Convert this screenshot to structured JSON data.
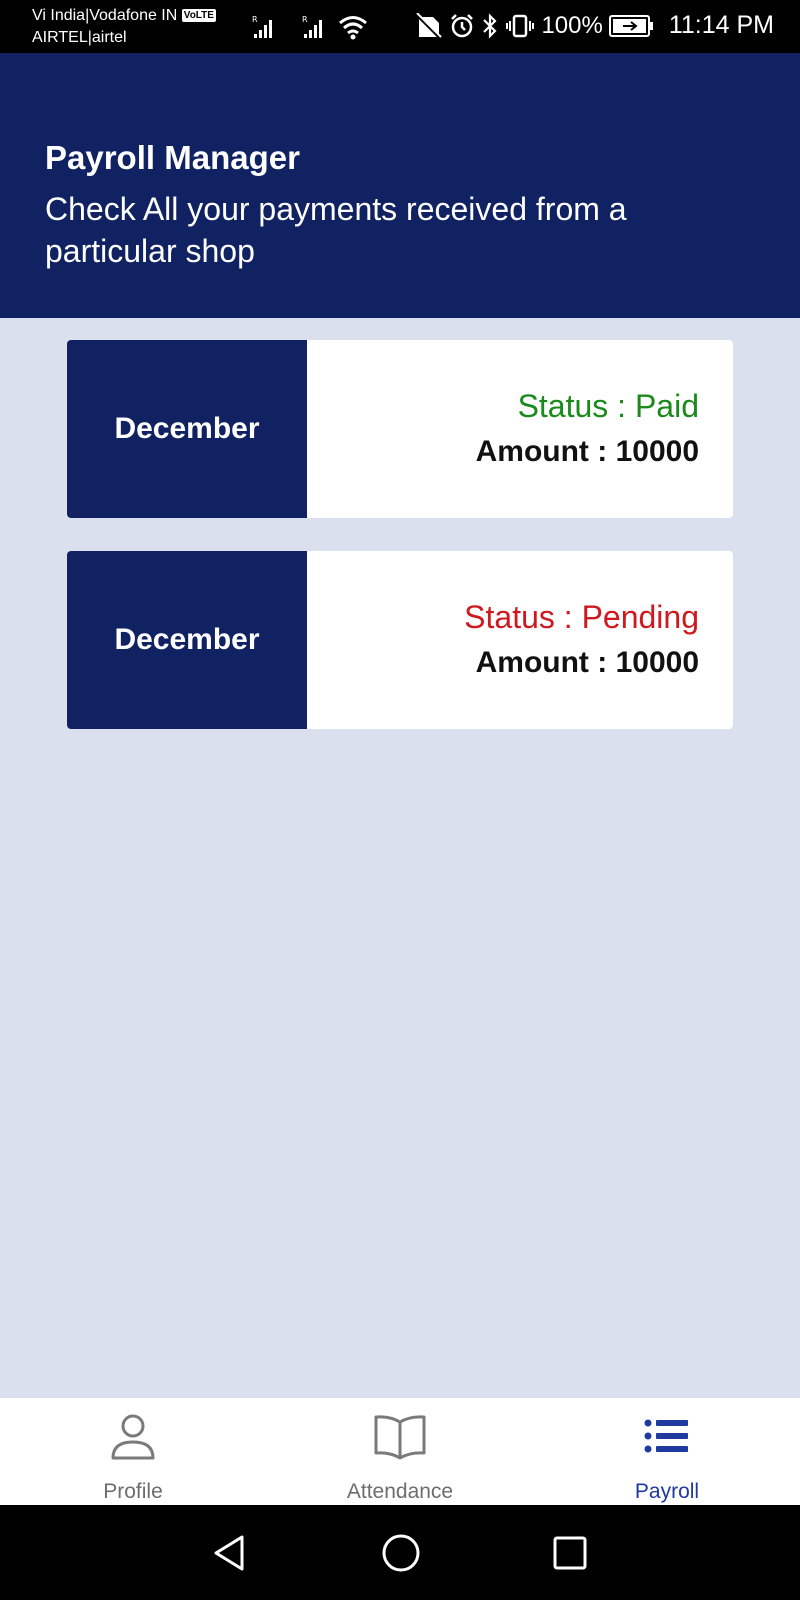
{
  "status_bar": {
    "carrier_line1": "Vi India|Vodafone IN",
    "volte": "VoLTE",
    "carrier_line2": "AIRTEL|airtel",
    "battery": "100%",
    "time": "11:14 PM"
  },
  "header": {
    "title": "Payroll Manager",
    "subtitle": "Check All your payments received from a particular shop",
    "background_color": "#112263"
  },
  "payments": [
    {
      "month": "December",
      "status_text": "Status : Paid",
      "status_color": "#1a8a1a",
      "amount_text": "Amount : 10000"
    },
    {
      "month": "December",
      "status_text": "Status : Pending",
      "status_color": "#d0191f",
      "amount_text": "Amount : 10000"
    }
  ],
  "bottom_nav": {
    "items": [
      {
        "label": "Profile",
        "icon": "person-icon",
        "active": false
      },
      {
        "label": "Attendance",
        "icon": "book-icon",
        "active": false
      },
      {
        "label": "Payroll",
        "icon": "list-icon",
        "active": true
      }
    ],
    "active_color": "#1f3a9f"
  },
  "system_nav": {
    "buttons": [
      "back-icon",
      "home-icon",
      "recents-icon"
    ]
  }
}
